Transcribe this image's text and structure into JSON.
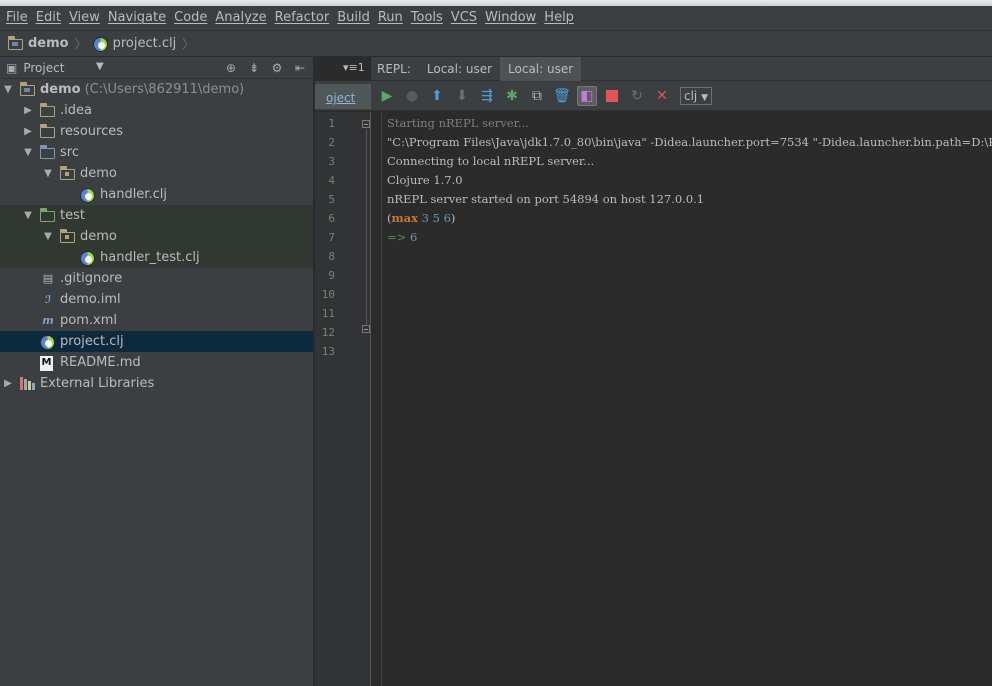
{
  "menu": [
    "File",
    "Edit",
    "View",
    "Navigate",
    "Code",
    "Analyze",
    "Refactor",
    "Build",
    "Run",
    "Tools",
    "VCS",
    "Window",
    "Help"
  ],
  "breadcrumb": {
    "project": "demo",
    "file": "project.clj"
  },
  "project_panel": {
    "title": "Project",
    "tree": [
      {
        "label": "demo",
        "hint": "(C:\\Users\\862911\\demo)",
        "icon": "module-folder-icon",
        "depth": 0,
        "arrow": "▼",
        "bold": true
      },
      {
        "label": ".idea",
        "icon": "folder-icon",
        "depth": 1,
        "arrow": "▶"
      },
      {
        "label": "resources",
        "icon": "folder-icon",
        "depth": 1,
        "arrow": "▶"
      },
      {
        "label": "src",
        "icon": "source-folder-icon",
        "depth": 1,
        "arrow": "▼"
      },
      {
        "label": "demo",
        "icon": "package-icon",
        "depth": 2,
        "arrow": "▼"
      },
      {
        "label": "handler.clj",
        "icon": "clojure-file-icon",
        "depth": 3,
        "arrow": ""
      },
      {
        "label": "test",
        "icon": "test-folder-icon",
        "depth": 1,
        "arrow": "▼",
        "test": true
      },
      {
        "label": "demo",
        "icon": "package-icon",
        "depth": 2,
        "arrow": "▼",
        "test": true
      },
      {
        "label": "handler_test.clj",
        "icon": "clojure-file-icon",
        "depth": 3,
        "arrow": "",
        "test": true
      },
      {
        "label": ".gitignore",
        "icon": "text-file-icon",
        "depth": 1,
        "arrow": ""
      },
      {
        "label": "demo.iml",
        "icon": "iml-file-icon",
        "depth": 1,
        "arrow": ""
      },
      {
        "label": "pom.xml",
        "icon": "maven-file-icon",
        "depth": 1,
        "arrow": ""
      },
      {
        "label": "project.clj",
        "icon": "clojure-file-icon",
        "depth": 1,
        "arrow": "",
        "selected": true
      },
      {
        "label": "README.md",
        "icon": "markdown-file-icon",
        "depth": 1,
        "arrow": ""
      },
      {
        "label": "External Libraries",
        "icon": "libraries-icon",
        "depth": 0,
        "arrow": "▶"
      }
    ]
  },
  "editor": {
    "file_tab": "oject",
    "tab_menu": "▾≡1",
    "line_numbers": [
      "1",
      "2",
      "3",
      "4",
      "5",
      "6",
      "7",
      "8",
      "9",
      "10",
      "11",
      "12",
      "13"
    ]
  },
  "repl": {
    "label": "REPL:",
    "tabs": [
      "Local: user",
      "Local: user"
    ],
    "active_tab": 1,
    "namespace": "clj",
    "output": {
      "starting": "Starting nREPL server...",
      "command": "\"C:\\Program Files\\Java\\jdk1.7.0_80\\bin\\java\" -Didea.launcher.port=7534 \"-Didea.launcher.bin.path=D:\\P",
      "connecting": "Connecting to local nREPL server...",
      "clojure": "Clojure 1.7.0",
      "started": "nREPL server started on port 54894 on host 127.0.0.1",
      "expr_open": "(",
      "expr_fn": "max",
      "expr_args": " 3 5 6",
      "expr_close": ")",
      "result_arrow": "=>",
      "result": "6"
    }
  },
  "colors": {
    "background": "#2b2b2b",
    "panel": "#3c3f41",
    "selection": "#0d293e",
    "keyword": "#cc7832",
    "number": "#6897bb"
  }
}
